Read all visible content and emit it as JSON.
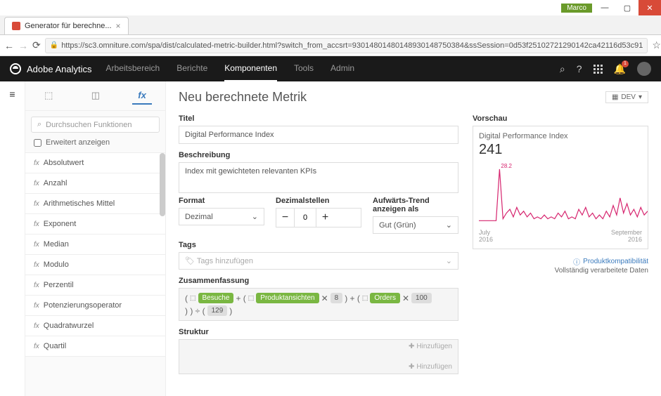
{
  "window": {
    "user": "Marco"
  },
  "browser": {
    "tab_title": "Generator für berechne...",
    "url": "https://sc3.omniture.com/spa/dist/calculated-metric-builder.html?switch_from_accsrt=93014801480148930148750384&ssSession=0d53f25102721290142ca42116d53c91"
  },
  "header": {
    "product": "Adobe Analytics",
    "nav": [
      "Arbeitsbereich",
      "Berichte",
      "Komponenten",
      "Tools",
      "Admin"
    ],
    "active_nav": "Komponenten",
    "bell_count": "1"
  },
  "sidebar": {
    "search_placeholder": "Durchsuchen Funktionen",
    "extended_label": "Erweitert anzeigen",
    "functions": [
      "Absolutwert",
      "Anzahl",
      "Arithmetisches Mittel",
      "Exponent",
      "Median",
      "Modulo",
      "Perzentil",
      "Potenzierungsoperator",
      "Quadratwurzel",
      "Quartil"
    ]
  },
  "main": {
    "page_title": "Neu berechnete Metrik",
    "dev_label": "DEV",
    "labels": {
      "title": "Titel",
      "desc": "Beschreibung",
      "format": "Format",
      "decimals": "Dezimalstellen",
      "trend": "Aufwärts-Trend anzeigen als",
      "tags": "Tags",
      "summary": "Zusammenfassung",
      "struct": "Struktur",
      "preview": "Vorschau"
    },
    "title_value": "Digital Performance Index",
    "desc_value": "Index mit gewichteten relevanten KPIs",
    "format_value": "Dezimal",
    "decimals_value": "0",
    "trend_value": "Gut (Grün)",
    "tags_placeholder": "Tags hinzufügen",
    "summary": {
      "seg1": "Besuche",
      "seg2": "Produktansichten",
      "seg3": "Orders",
      "num1": "8",
      "num2": "100",
      "num3": "129"
    },
    "add_label": "Hinzufügen"
  },
  "preview": {
    "metric_name": "Digital Performance Index",
    "value": "241",
    "peak_label": "28.2",
    "date_from_m": "July",
    "date_from_y": "2016",
    "date_to_m": "September",
    "date_to_y": "2016",
    "compat_link": "Produktkompatibilität",
    "compat_text": "Vollständig verarbeitete Daten"
  },
  "chart_data": {
    "type": "line",
    "title": "Digital Performance Index",
    "xlabel": "",
    "ylabel": "",
    "ylim": [
      0,
      30
    ],
    "x": [
      0,
      1,
      2,
      3,
      4,
      5,
      6,
      7,
      8,
      9,
      10,
      11,
      12,
      13,
      14,
      15,
      16,
      17,
      18,
      19,
      20,
      21,
      22,
      23,
      24,
      25,
      26,
      27,
      28,
      29,
      30,
      31,
      32,
      33,
      34,
      35,
      36,
      37,
      38,
      39,
      40,
      41,
      42,
      43,
      44,
      45,
      46,
      47,
      48,
      49
    ],
    "values": [
      1,
      1,
      1,
      1,
      1,
      1,
      28.2,
      2,
      5,
      7,
      3,
      8,
      4,
      6,
      3,
      5,
      2,
      3,
      2,
      4,
      2,
      3,
      2,
      5,
      3,
      6,
      2,
      3,
      2,
      7,
      4,
      8,
      3,
      5,
      2,
      4,
      2,
      6,
      3,
      9,
      4,
      13,
      5,
      10,
      4,
      7,
      3,
      8,
      4,
      6
    ]
  }
}
